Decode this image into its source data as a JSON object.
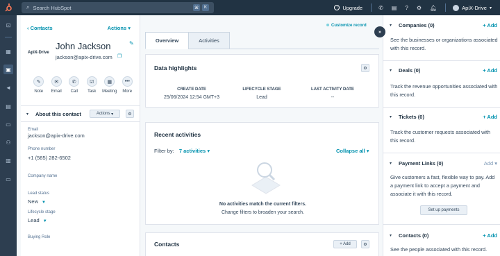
{
  "topnav": {
    "search_placeholder": "Search HubSpot",
    "kbd1": "⌘",
    "kbd2": "K",
    "upgrade": "Upgrade",
    "account": "ApiX-Drive",
    "icons": [
      "phone-icon",
      "marketplace-icon",
      "help-icon",
      "settings-icon",
      "notifications-icon"
    ]
  },
  "rail": {
    "icons": [
      "bookmark-icon",
      "contacts-icon",
      "apps-icon",
      "crm-icon",
      "marketing-icon",
      "content-icon",
      "commerce-icon",
      "automation-icon",
      "reports-icon",
      "files-icon"
    ]
  },
  "contact": {
    "back_label": "Contacts",
    "actions_label": "Actions",
    "logo_text": "ApiX-Drive",
    "name": "John Jackson",
    "email": "jackson@apix-drive.com",
    "activity_buttons": [
      "Note",
      "Email",
      "Call",
      "Task",
      "Meeting",
      "More"
    ]
  },
  "about": {
    "title": "About this contact",
    "actions_label": "Actions",
    "fields": [
      {
        "label": "Email",
        "value": "jackson@apix-drive.com"
      },
      {
        "label": "Phone number",
        "value": "+1 (585) 282-6502"
      },
      {
        "label": "Company name",
        "value": ""
      },
      {
        "label": "Lead status",
        "value": "New"
      },
      {
        "label": "Lifecycle stage",
        "value": "Lead"
      },
      {
        "label": "Buying Role",
        "value": ""
      }
    ]
  },
  "main": {
    "customize_label": "Customize record",
    "tabs": [
      "Overview",
      "Activities"
    ],
    "highlights": {
      "title": "Data highlights",
      "columns": [
        {
          "header": "CREATE DATE",
          "value": "25/06/2024 12:54 GMT+3"
        },
        {
          "header": "LIFECYCLE STAGE",
          "value": "Lead"
        },
        {
          "header": "LAST ACTIVITY DATE",
          "value": "--"
        }
      ]
    },
    "recent": {
      "title": "Recent activities",
      "filter_label": "Filter by:",
      "filter_value": "7 activities",
      "collapse_label": "Collapse all",
      "empty_title": "No activities match the current filters.",
      "empty_sub": "Change filters to broaden your search."
    },
    "contacts_card": {
      "title": "Contacts",
      "add_label": "+ Add"
    }
  },
  "sidebar": {
    "sections": [
      {
        "title": "Companies (0)",
        "add": "+ Add",
        "desc": "See the businesses or organizations associated with this record."
      },
      {
        "title": "Deals (0)",
        "add": "+ Add",
        "desc": "Track the revenue opportunities associated with this record."
      },
      {
        "title": "Tickets (0)",
        "add": "+ Add",
        "desc": "Track the customer requests associated with this record."
      },
      {
        "title": "Payment Links (0)",
        "add": "Add",
        "desc": "Give customers a fast, flexible way to pay. Add a payment link to accept a payment and associate it with this record.",
        "button": "Set up payments"
      },
      {
        "title": "Contacts (0)",
        "add": "+ Add",
        "desc": "See the people associated with this record."
      }
    ]
  },
  "colors": {
    "nav": "#213343",
    "link": "#0091ae",
    "brand": "#ff7a59"
  }
}
